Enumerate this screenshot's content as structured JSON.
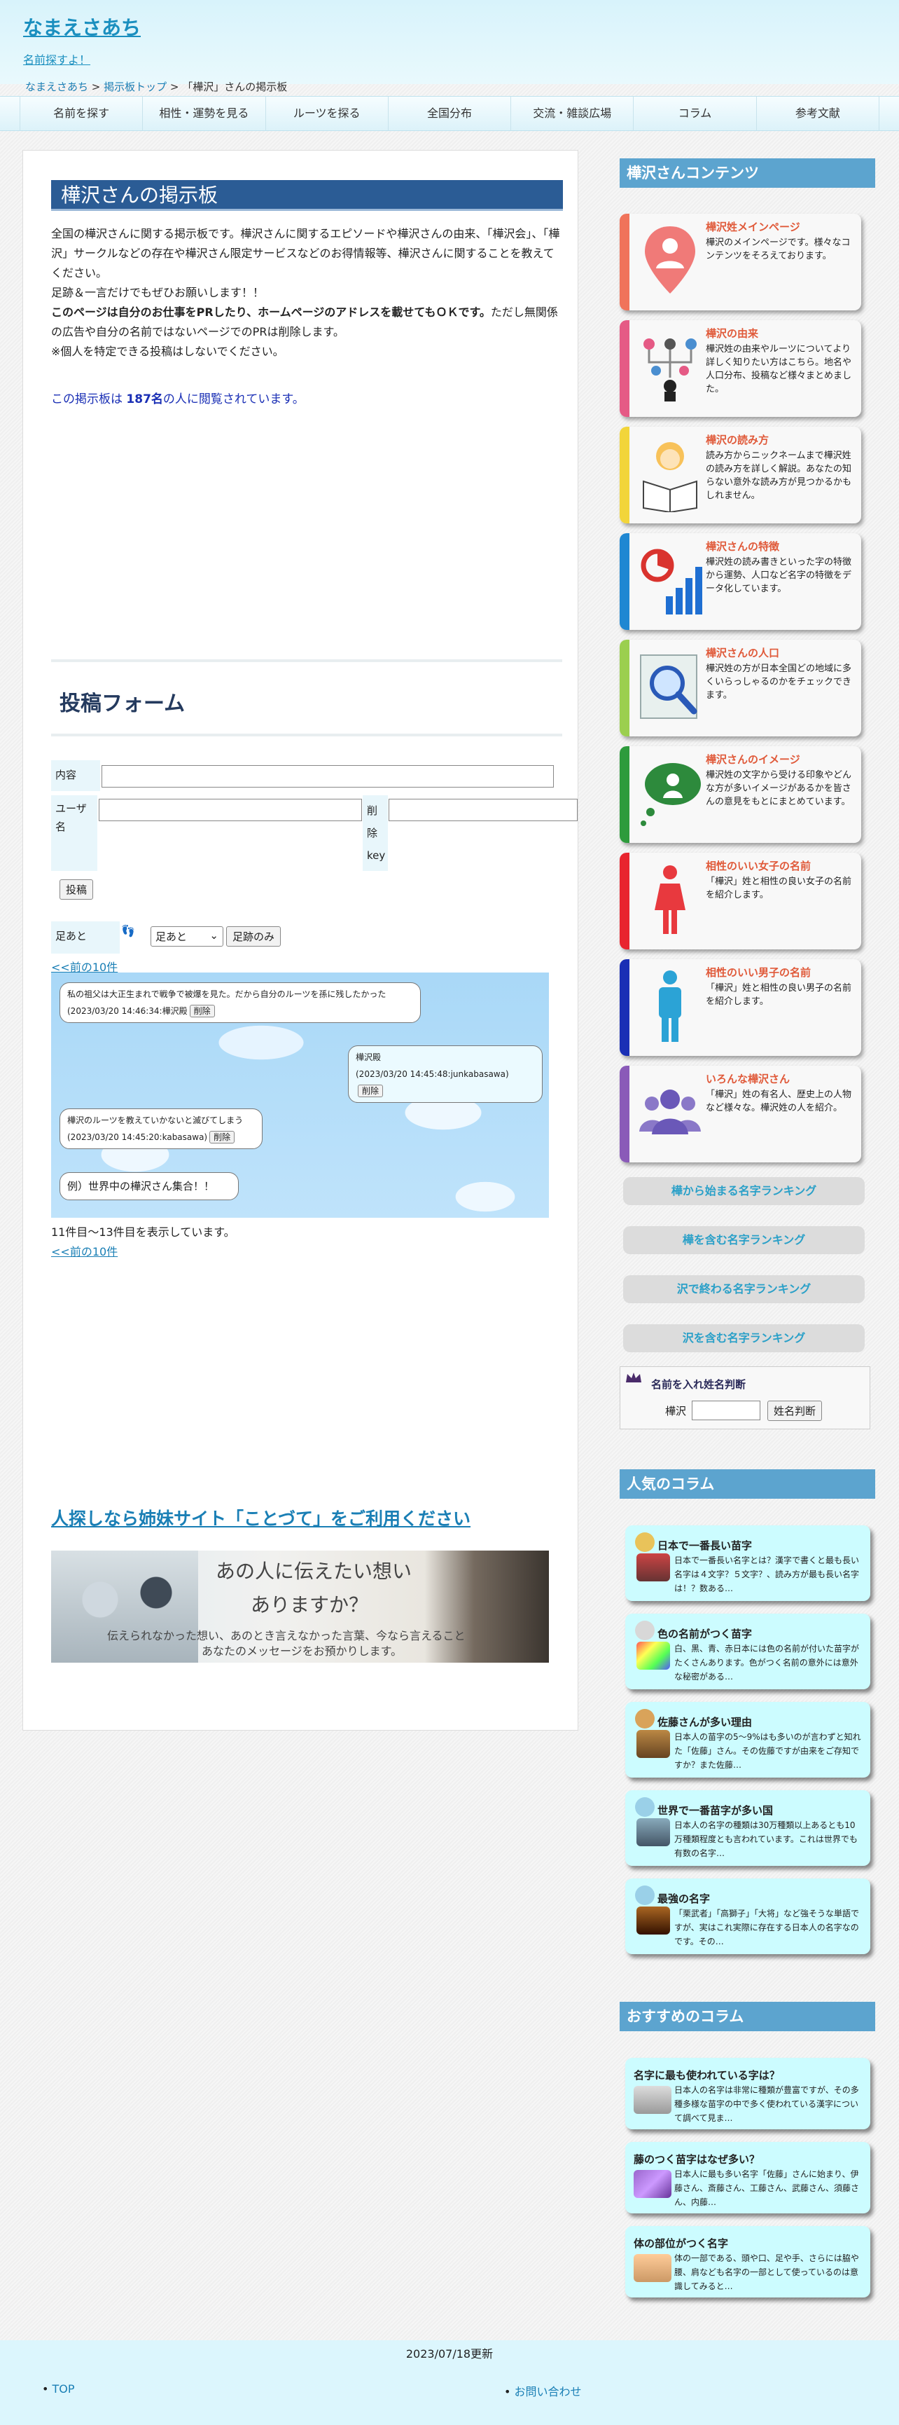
{
  "header": {
    "site_title": "なまえさあち",
    "site_sub": "名前探すよ！"
  },
  "breadcrumb": {
    "home": "なまえさあち",
    "sep1": " > ",
    "board_top": "掲示板トップ",
    "sep2": " > ",
    "current": "「樺沢」さんの掲示板"
  },
  "nav": [
    "名前を探す",
    "相性・運勢を見る",
    "ルーツを探る",
    "全国分布",
    "交流・雑談広場",
    "コラム",
    "参考文献"
  ],
  "board": {
    "title": "樺沢さんの掲示板",
    "desc1": "全国の樺沢さんに関する掲示板です。樺沢さんに関するエピソードや樺沢さんの由来、「樺沢会」、「樺沢」サークルなどの存在や樺沢さん限定サービスなどのお得情報等、樺沢さんに関することを教えてください。",
    "desc2": "足跡＆一言だけでもぜひお願いします！！",
    "desc3_bold": "このページは自分のお仕事をPRしたり、ホームページのアドレスを載せてもＯＫです。",
    "desc3_rest": "ただし無関係の広告や自分の名前ではないページでのPRは削除します。",
    "desc4": "※個人を特定できる投稿はしないでください。",
    "counter_pre": "この掲示板は ",
    "counter_num": "187名",
    "counter_post": "の人に閲覧されています。"
  },
  "form": {
    "title": "投稿フォーム",
    "content_label": "内容",
    "user_label": "ユーザ名",
    "del_label": "削除key",
    "post_button": "投稿",
    "footprint_label": "足あと",
    "footprint_select": "足あと",
    "footprint_button": "足跡のみ"
  },
  "prev_link": "<<前の10件",
  "posts": [
    {
      "text": "私の祖父は大正生まれで戦争で被爆を見た。だから自分のルーツを孫に残したかった",
      "meta": "(2023/03/20 14:46:34:樺沢殿",
      "del": "削除",
      "side": "left"
    },
    {
      "text": "樺沢殿",
      "meta": "(2023/03/20 14:45:48:junkabasawa)",
      "del": "削除",
      "side": "right"
    },
    {
      "text": "樺沢のルーツを教えていかないと滅びてしまう",
      "meta": "(2023/03/20 14:45:20:kabasawa)",
      "del": "削除",
      "side": "left"
    },
    {
      "text": "例）世界中の樺沢さん集合！！",
      "meta": "",
      "del": "",
      "side": "left"
    }
  ],
  "showing": "11件目〜13件目を表示しています。",
  "sister": {
    "title": "人探しなら姉妹サイト「ことづて」をご利用ください",
    "line1": "あの人に伝えたい想い",
    "line2": "ありますか？",
    "line3": "伝えられなかった想い、あのとき言えなかった言葉、今なら言えること",
    "line4": "あなたのメッセージをお預かりします。"
  },
  "sidebar": {
    "contents_head": "樺沢さんコンテンツ",
    "cards": [
      {
        "title": "樺沢姓メインページ",
        "desc": "樺沢のメインページです。様々なコンテンツをそろえております。",
        "color": "#f0735a",
        "icon": "map-pin-person-icon"
      },
      {
        "title": "樺沢の由来",
        "desc": "樺沢姓の由来やルーツについてより詳しく知りたい方はこちら。地名や人口分布、投稿など様々まとめました。",
        "color": "#e55a85",
        "icon": "family-tree-icon"
      },
      {
        "title": "樺沢の読み方",
        "desc": "読み方からニックネームまで樺沢姓の読み方を詳しく解説。あなたの知らない意外な読み方が見つかるかもしれません。",
        "color": "#f2d53a",
        "icon": "reading-book-icon"
      },
      {
        "title": "樺沢さんの特徴",
        "desc": "樺沢姓の読み書きといった字の特徴から運勢、人口など名字の特徴をデータ化しています。",
        "color": "#1f87d2",
        "icon": "chart-icon"
      },
      {
        "title": "樺沢さんの人口",
        "desc": "樺沢姓の方が日本全国どの地域に多くいらっしゃるのかをチェックできます。",
        "color": "#9bcf4f",
        "icon": "magnifier-map-icon"
      },
      {
        "title": "樺沢さんのイメージ",
        "desc": "樺沢姓の文字から受ける印象やどんな方が多いイメージがあるかを皆さんの意見をもとにまとめています。",
        "color": "#2d9b3c",
        "icon": "thought-bubble-icon"
      },
      {
        "title": "相性のいい女子の名前",
        "desc": "「樺沢」姓と相性の良い女子の名前を紹介します。",
        "color": "#e8242e",
        "icon": "female-icon"
      },
      {
        "title": "相性のいい男子の名前",
        "desc": "「樺沢」姓と相性の良い男子の名前を紹介します。",
        "color": "#1a2fb5",
        "icon": "male-icon"
      },
      {
        "title": "いろんな樺沢さん",
        "desc": "「樺沢」姓の有名人、歴史上の人物など様々な。樺沢姓の人を紹介。",
        "color": "#8a5ab8",
        "icon": "people-group-icon"
      }
    ],
    "ranks": [
      "樺から始まる名字ランキング",
      "樺を含む名字ランキング",
      "沢で終わる名字ランキング",
      "沢を含む名字ランキング"
    ],
    "judge_title": "名前を入れ姓名判断",
    "judge_surname": "樺沢",
    "judge_button": "姓名判断",
    "popular_head": "人気のコラム",
    "popular": [
      {
        "title": "日本で一番長い苗字",
        "desc": "日本で一番長い名字とは？漢字で書くと最も長い名字は４文字？５文字？、読み方が最も長い名字は！？数ある…"
      },
      {
        "title": "色の名前がつく苗字",
        "desc": "白、黒、青、赤日本には色の名前が付いた苗字がたくさんあります。色がつく名前の意外には意外な秘密がある…"
      },
      {
        "title": "佐藤さんが多い理由",
        "desc": "日本人の苗字の5〜9%はも多いのが言わずと知れた「佐藤」さん。その佐藤ですが由来をご存知ですか？また佐藤…"
      },
      {
        "title": "世界で一番苗字が多い国",
        "desc": "日本人の名字の種類は30万種類以上あるとも10万種類程度とも言われています。これは世界でも有数の名字…"
      },
      {
        "title": "最強の名字",
        "desc": "「栗武者」「高獅子」「大将」など強そうな単語ですが、実はこれ実際に存在する日本人の名字なのです。その…"
      }
    ],
    "recommend_head": "おすすめのコラム",
    "recommend": [
      {
        "title": "名字に最も使われている字は？",
        "desc": "日本人の名字は非常に種類が豊富ですが、その多種多様な苗字の中で多く使われている漢字について調べて見ま…"
      },
      {
        "title": "藤のつく苗字はなぜ多い？",
        "desc": "日本人に最も多い名字「佐藤」さんに始まり、伊藤さん、斎藤さん、工藤さん、武藤さん、須藤さん、内藤…"
      },
      {
        "title": "体の部位がつく名字",
        "desc": "体の一部である、頭や口、足や手、さらには脇や腰、肩なども名字の一部として使っているのは意識してみると…"
      }
    ]
  },
  "footer": {
    "updated": "2023/07/18更新",
    "top": "TOP",
    "contact": "お問い合わせ"
  }
}
